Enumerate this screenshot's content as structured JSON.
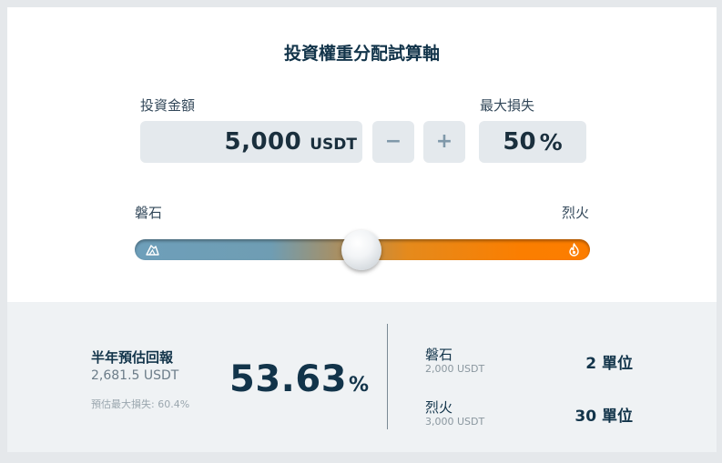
{
  "title": "投資權重分配試算軸",
  "investment": {
    "label": "投資金額",
    "value": "5,000",
    "unit": "USDT",
    "minus_symbol": "−",
    "plus_symbol": "+"
  },
  "max_loss": {
    "label": "最大損失",
    "value": "50",
    "unit": "%"
  },
  "slider": {
    "left_label": "磐石",
    "right_label": "烈火",
    "left_icon": "rock-icon",
    "right_icon": "fire-icon",
    "position": 0.5,
    "colors": {
      "left": "#6e9fba",
      "right": "#fc7d00"
    }
  },
  "result": {
    "title": "半年預估回報",
    "usdt": "2,681.5 USDT",
    "estimated_max_loss": "預估最大損失: 60.4%",
    "percent": "53.63",
    "percent_unit": "%"
  },
  "allocation": [
    {
      "name": "磐石",
      "amount": "2,000 USDT",
      "units": "2 單位"
    },
    {
      "name": "烈火",
      "amount": "3,000 USDT",
      "units": "30 單位"
    }
  ]
}
